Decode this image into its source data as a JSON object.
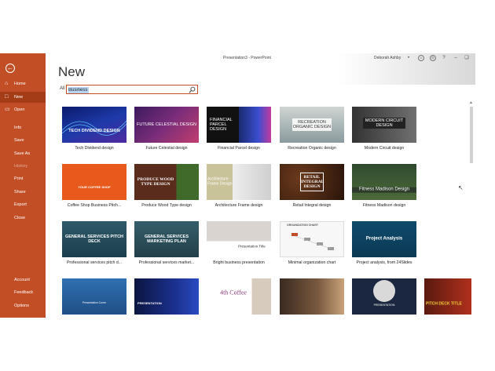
{
  "titlebar": {
    "title": "Presentation3 - PowerPoint",
    "user": "Deborah Ashby"
  },
  "sidebar": {
    "back_icon": "back-arrow-icon",
    "items": [
      {
        "label": "Home",
        "icon": "home-icon"
      },
      {
        "label": "New",
        "icon": "new-doc-icon"
      },
      {
        "label": "Open",
        "icon": "folder-icon"
      },
      {
        "label": "Info"
      },
      {
        "label": "Save"
      },
      {
        "label": "Save As"
      },
      {
        "label": "History"
      },
      {
        "label": "Print"
      },
      {
        "label": "Share"
      },
      {
        "label": "Export"
      },
      {
        "label": "Close"
      },
      {
        "label": "Account"
      },
      {
        "label": "Feedback"
      },
      {
        "label": "Options"
      }
    ]
  },
  "page": {
    "title": "New"
  },
  "search": {
    "label": "All",
    "value": "Business"
  },
  "templates": [
    {
      "name": "Tech Dividend design",
      "text": "TECH DIVIDEND DESIGN"
    },
    {
      "name": "Future Celestial design",
      "text": "FUTURE CELESTIAL DESIGN"
    },
    {
      "name": "Financial Parcel design",
      "text": "FINANCIAL PARCEL DESIGN"
    },
    {
      "name": "Recreation Organic design",
      "text": "RECREATION ORGANIC DESIGN"
    },
    {
      "name": "Modern Circuit design",
      "text": "MODERN CIRCUIT DESIGN"
    },
    {
      "name": "Coffee Shop Business Pitch...",
      "text": "YOUR COFFEE SHOP"
    },
    {
      "name": "Produce Wood Type design",
      "text": "PRODUCE WOOD TYPE DESIGN"
    },
    {
      "name": "Architecture Frame design",
      "text": "Architecture Frame Design"
    },
    {
      "name": "Retail Integral design",
      "text": "RETAIL INTEGRAL DESIGN"
    },
    {
      "name": "Fitness Madison design",
      "text": "Fitness Madison Design"
    },
    {
      "name": "Professional services pitch d...",
      "text": "GENERAL SERVICES PITCH DECK"
    },
    {
      "name": "Professional services market...",
      "text": "GENERAL SERVICES MARKETING PLAN"
    },
    {
      "name": "Bright business presentation",
      "text": "Presentation Title"
    },
    {
      "name": "Minimal organization chart",
      "text": "ORGANIZATION CHART"
    },
    {
      "name": "Project analysis, from 24Slides",
      "text": "Project Analysis"
    },
    {
      "name": "",
      "text": "Presentation Cover"
    },
    {
      "name": "",
      "text": "PRESENTATION"
    },
    {
      "name": "",
      "text": "4th Coffee"
    },
    {
      "name": "",
      "text": ""
    },
    {
      "name": "",
      "text": "PRESENTATION"
    },
    {
      "name": "",
      "text": "PITCH DECK TITLE"
    }
  ],
  "colors": {
    "accent": "#c24e26",
    "sidebar_active": "#a33c17"
  }
}
